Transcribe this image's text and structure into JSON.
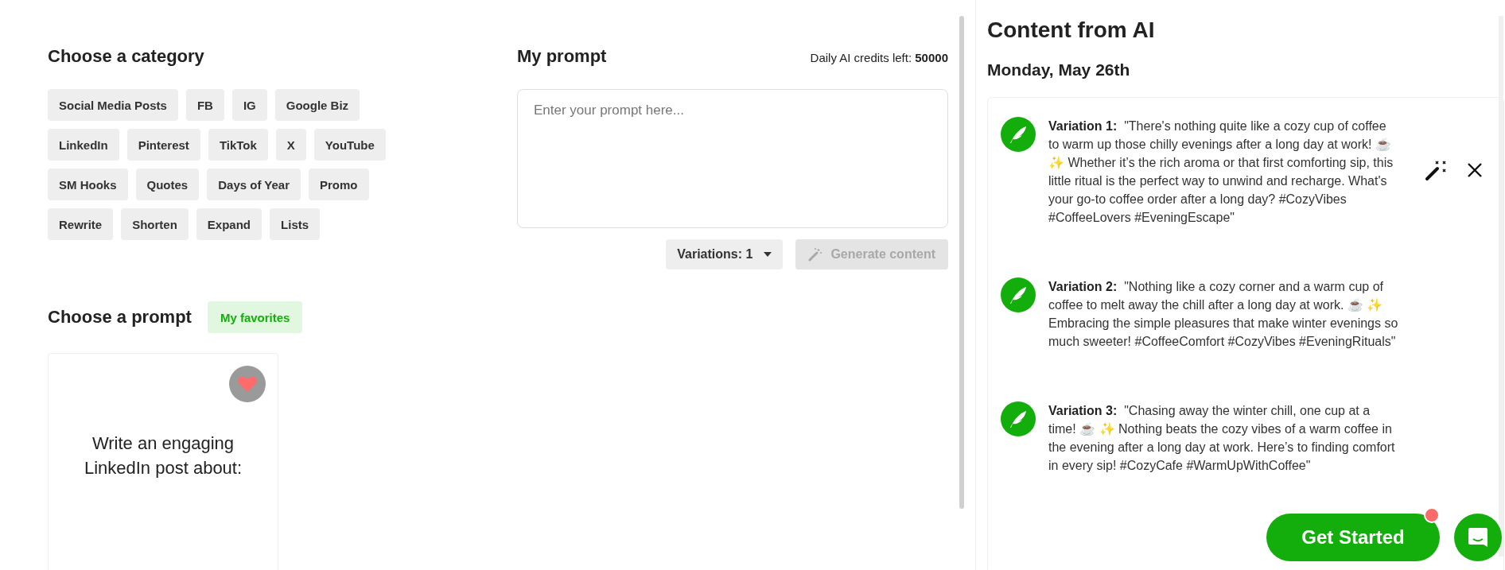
{
  "category_section": {
    "title": "Choose a category",
    "chips": [
      [
        "Social Media Posts",
        "FB",
        "IG",
        "Google Biz"
      ],
      [
        "LinkedIn",
        "Pinterest",
        "TikTok",
        "X",
        "YouTube"
      ],
      [
        "SM Hooks",
        "Quotes",
        "Days of Year",
        "Promo"
      ],
      [
        "Rewrite",
        "Shorten",
        "Expand",
        "Lists"
      ]
    ]
  },
  "prompt_section": {
    "title": "My prompt",
    "credits_label": "Daily AI credits left:",
    "credits_value": "50000",
    "placeholder": "Enter your prompt here...",
    "variations_select": "Variations: 1",
    "generate_button": {
      "label": "Generate content",
      "disabled": true
    }
  },
  "choose_prompt": {
    "title": "Choose a prompt",
    "favorites_button": "My favorites",
    "cards": [
      {
        "text": "Write an engaging LinkedIn post about:"
      }
    ]
  },
  "ai_content": {
    "title": "Content from AI",
    "date": "Monday, May 26th",
    "variations": [
      {
        "label": "Variation 1:",
        "text": "\"There's nothing quite like a cozy cup of coffee to warm up those chilly evenings after a long day at work! ☕ ✨ Whether it’s the rich aroma or that first comforting sip, this little ritual is the perfect way to unwind and recharge. What's your go-to coffee order after a long day? #CozyVibes #CoffeeLovers #EveningEscape\""
      },
      {
        "label": "Variation 2:",
        "text": "\"Nothing like a cozy corner and a warm cup of coffee to melt away the chill after a long day at work. ☕ ✨ Embracing the simple pleasures that make winter evenings so much sweeter! #CoffeeComfort #CozyVibes #EveningRituals\""
      },
      {
        "label": "Variation 3:",
        "text": "\"Chasing away the winter chill, one cup at a time! ☕ ✨ Nothing beats the cozy vibes of a warm coffee in the evening after a long day at work. Here’s to finding comfort in every sip! #CozyCafe #WarmUpWithCoffee\""
      }
    ]
  },
  "get_started_button": "Get Started"
}
